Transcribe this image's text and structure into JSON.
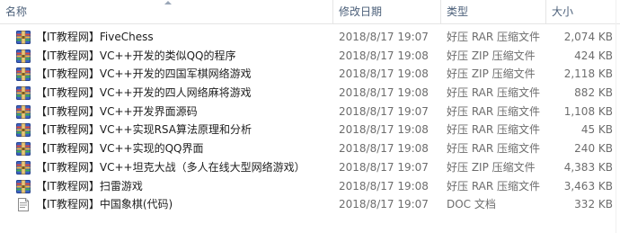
{
  "columns": {
    "name": "名称",
    "date": "修改日期",
    "type": "类型",
    "size": "大小"
  },
  "files": [
    {
      "name": "【IT教程网】FiveChess",
      "date": "2018/8/17 19:07",
      "type": "好压 RAR 压缩文件",
      "size": "2,074 KB",
      "icon": "archive-icon"
    },
    {
      "name": "【IT教程网】VC++开发的类似QQ的程序",
      "date": "2018/8/17 19:08",
      "type": "好压 ZIP 压缩文件",
      "size": "424 KB",
      "icon": "archive-icon"
    },
    {
      "name": "【IT教程网】VC++开发的四国军棋网络游戏",
      "date": "2018/8/17 19:08",
      "type": "好压 ZIP 压缩文件",
      "size": "2,118 KB",
      "icon": "archive-icon"
    },
    {
      "name": "【IT教程网】VC++开发的四人网络麻将游戏",
      "date": "2018/8/17 19:08",
      "type": "好压 RAR 压缩文件",
      "size": "882 KB",
      "icon": "archive-icon"
    },
    {
      "name": "【IT教程网】VC++开发界面源码",
      "date": "2018/8/17 19:07",
      "type": "好压 RAR 压缩文件",
      "size": "1,108 KB",
      "icon": "archive-icon"
    },
    {
      "name": "【IT教程网】VC++实现RSA算法原理和分析",
      "date": "2018/8/17 19:08",
      "type": "好压 RAR 压缩文件",
      "size": "45 KB",
      "icon": "archive-icon"
    },
    {
      "name": "【IT教程网】VC++实现的QQ界面",
      "date": "2018/8/17 19:08",
      "type": "好压 RAR 压缩文件",
      "size": "240 KB",
      "icon": "archive-icon"
    },
    {
      "name": "【IT教程网】VC++坦克大战（多人在线大型网络游戏）",
      "date": "2018/8/17 19:07",
      "type": "好压 ZIP 压缩文件",
      "size": "4,383 KB",
      "icon": "archive-icon"
    },
    {
      "name": "【IT教程网】扫雷游戏",
      "date": "2018/8/17 19:08",
      "type": "好压 RAR 压缩文件",
      "size": "3,463 KB",
      "icon": "archive-icon"
    },
    {
      "name": "【IT教程网】中国象棋(代码)",
      "date": "2018/8/17 19:07",
      "type": "DOC 文档",
      "size": "332 KB",
      "icon": "document-icon"
    }
  ],
  "colors": {
    "header_text": "#4c607a",
    "detail_text": "#6d6d6d",
    "name_text": "#1e1e1e"
  }
}
